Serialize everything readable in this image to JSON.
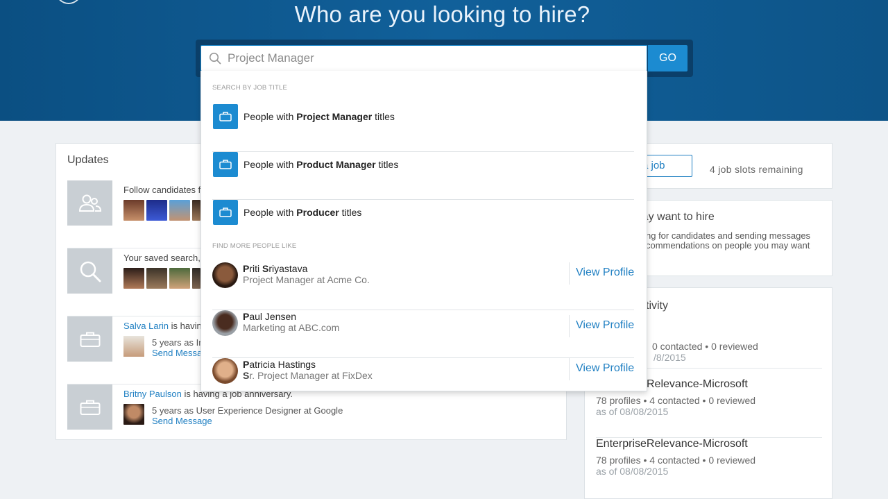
{
  "hero": {
    "title": "Who are you looking to hire?"
  },
  "search": {
    "value": "",
    "placeholder": "Project Manager",
    "go_label": "GO"
  },
  "dropdown": {
    "job_title_label": "SEARCH BY JOB TITLE",
    "suggestions": [
      {
        "prefix": "People with ",
        "bold": "Project Manager",
        "suffix": " titles"
      },
      {
        "prefix": "People with ",
        "bold": "Product Manager",
        "suffix": " titles"
      },
      {
        "prefix": "People with ",
        "bold": "Producer",
        "suffix": " titles"
      }
    ],
    "people_label": "FIND MORE PEOPLE LIKE",
    "people": [
      {
        "name_first": "P",
        "name_mid": "riti ",
        "name_s": "S",
        "name_rest": "riyastava",
        "role": "Project Manager at Acme Co.",
        "action": "View Profile"
      },
      {
        "name_first": "P",
        "name_rest": "aul Jensen",
        "role": "Marketing at ABC.com",
        "action": "View Profile"
      },
      {
        "name_first": "P",
        "name_rest": "atricia Hastings",
        "role_first": "S",
        "role_rest": "r. Project Manager at FixDex",
        "action": "View Profile"
      }
    ]
  },
  "updates": {
    "title": "Updates",
    "items": [
      {
        "text": "Follow candidates f",
        "icon": "users-icon"
      },
      {
        "text": "Your saved search,",
        "icon": "search-icon"
      },
      {
        "link": "Salva Larin",
        "text": " is havin",
        "sub_line": "5 years as In",
        "sub_link": "Send Messa",
        "icon": "briefcase-icon"
      },
      {
        "link": "Britny Paulson",
        "text": " is having a job anniversary.",
        "sub_line": "5 years as User Experience Designer at Google",
        "sub_link": "Send Message",
        "icon": "briefcase-icon"
      }
    ]
  },
  "post_job": {
    "button_label": "a job",
    "slots": "4 job slots remaining"
  },
  "may_hire": {
    "title": "u may want to hire",
    "body_line1": "ng for candidates and sending messages",
    "body_line2": "commendations on people you may want"
  },
  "activity": {
    "title": "tivity",
    "projects": [
      {
        "name": "",
        "stats": "0 contacted  •  0 reviewed",
        "date": "/8/2015",
        "stats_offset": true
      },
      {
        "name": "Relevance-Microsoft",
        "stats": "78 profiles  •  4 contacted  •  0 reviewed",
        "date": "as of 08/08/2015",
        "name_offset": true
      },
      {
        "name": "EnterpriseRelevance-Microsoft",
        "stats": "78 profiles  •  4 contacted  •  0 reviewed",
        "date": "as of 08/08/2015"
      }
    ]
  },
  "colors": {
    "brand": "#11609a",
    "accent": "#1c8bd1",
    "link": "#1f7fc2"
  }
}
